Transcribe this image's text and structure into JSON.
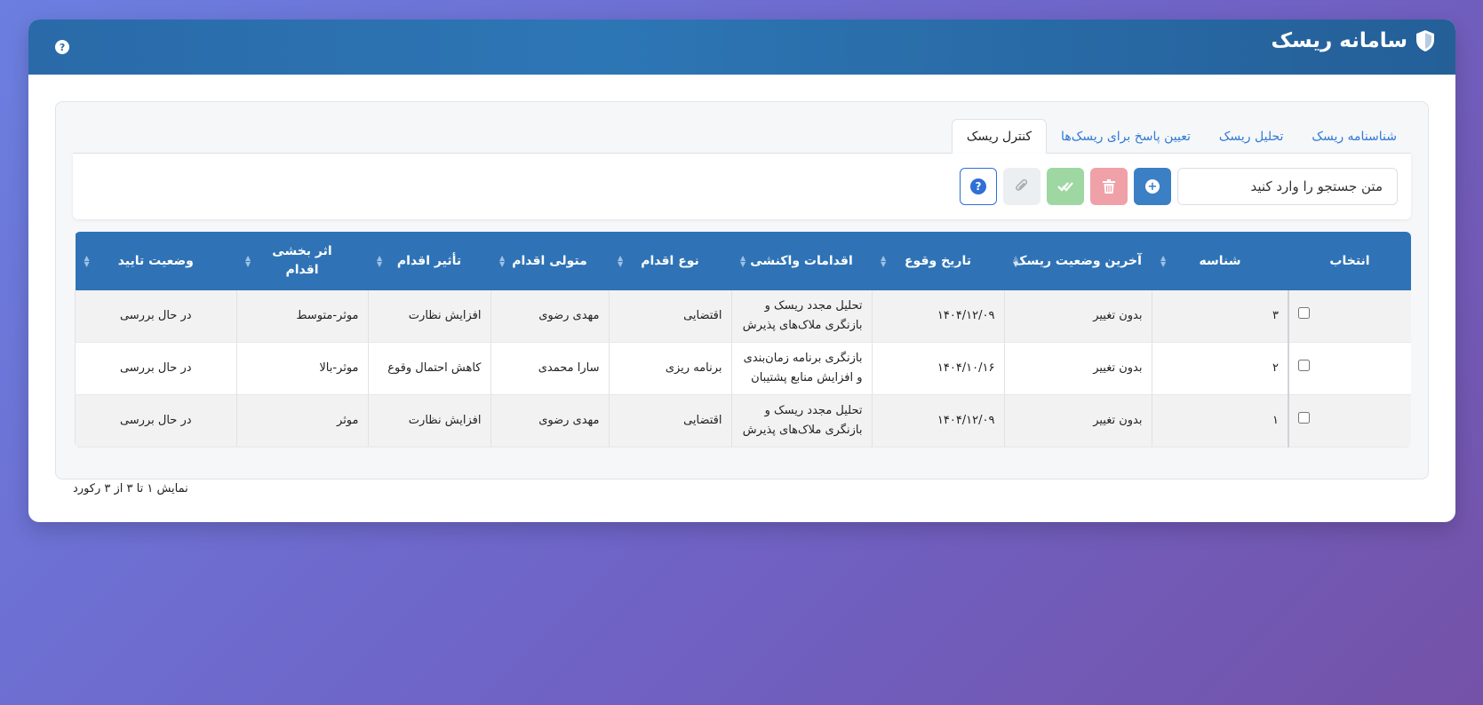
{
  "app": {
    "title": "سامانه ریسک",
    "help_icon": "question-icon"
  },
  "tabs": [
    {
      "label": "شناسنامه ریسک",
      "active": false
    },
    {
      "label": "تحلیل ریسک",
      "active": false
    },
    {
      "label": "تعیین پاسخ برای ریسک‌ها",
      "active": false
    },
    {
      "label": "کنترل ریسک",
      "active": true
    }
  ],
  "toolbar": {
    "search_placeholder": "متن جستجو را وارد کنید",
    "buttons": [
      "add",
      "delete",
      "approve",
      "attach",
      "help"
    ]
  },
  "table": {
    "headers": [
      "انتخاب",
      "شناسه",
      "آخرین وضعیت ریسک",
      "تاریخ وقوع",
      "اقدامات واکنشی",
      "نوع اقدام",
      "متولی اقدام",
      "تأثیر اقدام",
      "اثر بخشی اقدام",
      "وضعیت تایید"
    ],
    "rows": [
      {
        "id": "۳",
        "status": "بدون تغییر",
        "date": "۱۴۰۴/۱۲/۰۹",
        "actions": "تحلیل مجدد ریسک و بازنگری ملاک‌های پذیرش",
        "type": "اقتضایی",
        "owner": "مهدی رضوی",
        "impact": "افزایش نظارت",
        "effect": "موثر-متوسط",
        "approval": "در حال بررسی"
      },
      {
        "id": "۲",
        "status": "بدون تغییر",
        "date": "۱۴۰۴/۱۰/۱۶",
        "actions": "بازنگری برنامه زمان‌بندی و افزایش منابع پشتیبان",
        "type": "برنامه ریزی",
        "owner": "سارا محمدی",
        "impact": "کاهش احتمال وقوع",
        "effect": "موثر-بالا",
        "approval": "در حال بررسی"
      },
      {
        "id": "۱",
        "status": "بدون تغییر",
        "date": "۱۴۰۴/۱۲/۰۹",
        "actions": "تحلیل مجدد ریسک و بازنگری ملاک‌های پذیرش",
        "type": "اقتضایی",
        "owner": "مهدی رضوی",
        "impact": "افزایش نظارت",
        "effect": "موثر",
        "approval": "در حال بررسی"
      }
    ]
  },
  "footer": {
    "info": "نمایش ۱ تا ۳ از ۳ رکورد"
  }
}
